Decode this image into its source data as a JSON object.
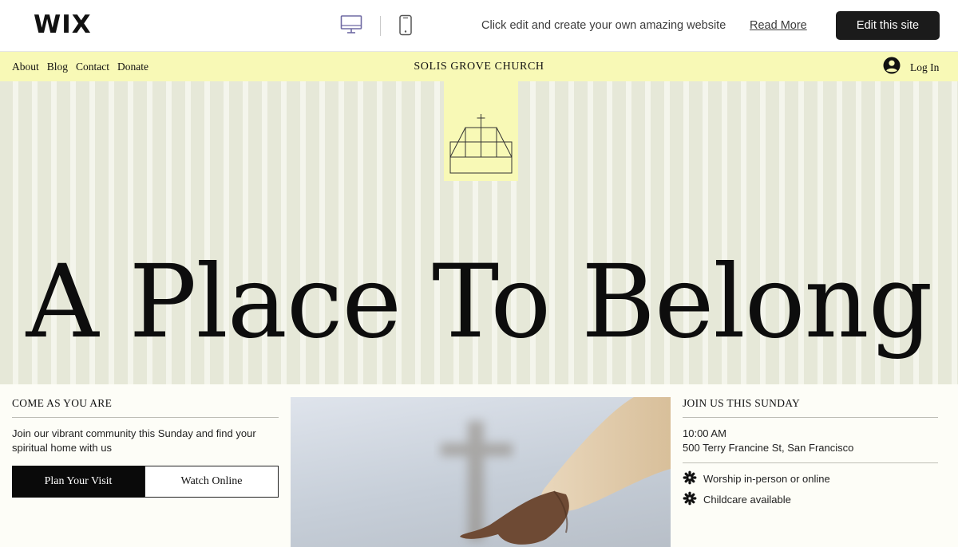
{
  "wix_bar": {
    "logo": "WIX",
    "promo_text": "Click edit and create your own amazing website",
    "read_more": "Read More",
    "edit_button": "Edit this site"
  },
  "site": {
    "title": "SOLIS GROVE CHURCH",
    "menu": [
      "About",
      "Blog",
      "Contact",
      "Donate"
    ],
    "login": "Log In"
  },
  "hero": {
    "title": "A Place To Belong"
  },
  "left": {
    "heading": "COME AS YOU ARE",
    "intro": "Join our vibrant community this Sunday and find your spiritual home with us",
    "primary_button": "Plan Your Visit",
    "secondary_button": "Watch Online"
  },
  "right": {
    "heading": "JOIN US THIS SUNDAY",
    "time": "10:00 AM",
    "address": "500 Terry Francine St, San Francisco",
    "features": [
      "Worship in-person or online",
      "Childcare available"
    ]
  },
  "colors": {
    "header_yellow": "#f8f9b6",
    "hero_bg": "#e9ebdc",
    "page_bg": "#fdfdf7",
    "dark": "#1b1b1b"
  },
  "icons": {
    "desktop": "desktop-icon",
    "mobile": "mobile-icon",
    "account": "account-icon",
    "logo": "church-logo-icon",
    "bullet": "asterisk-icon"
  }
}
